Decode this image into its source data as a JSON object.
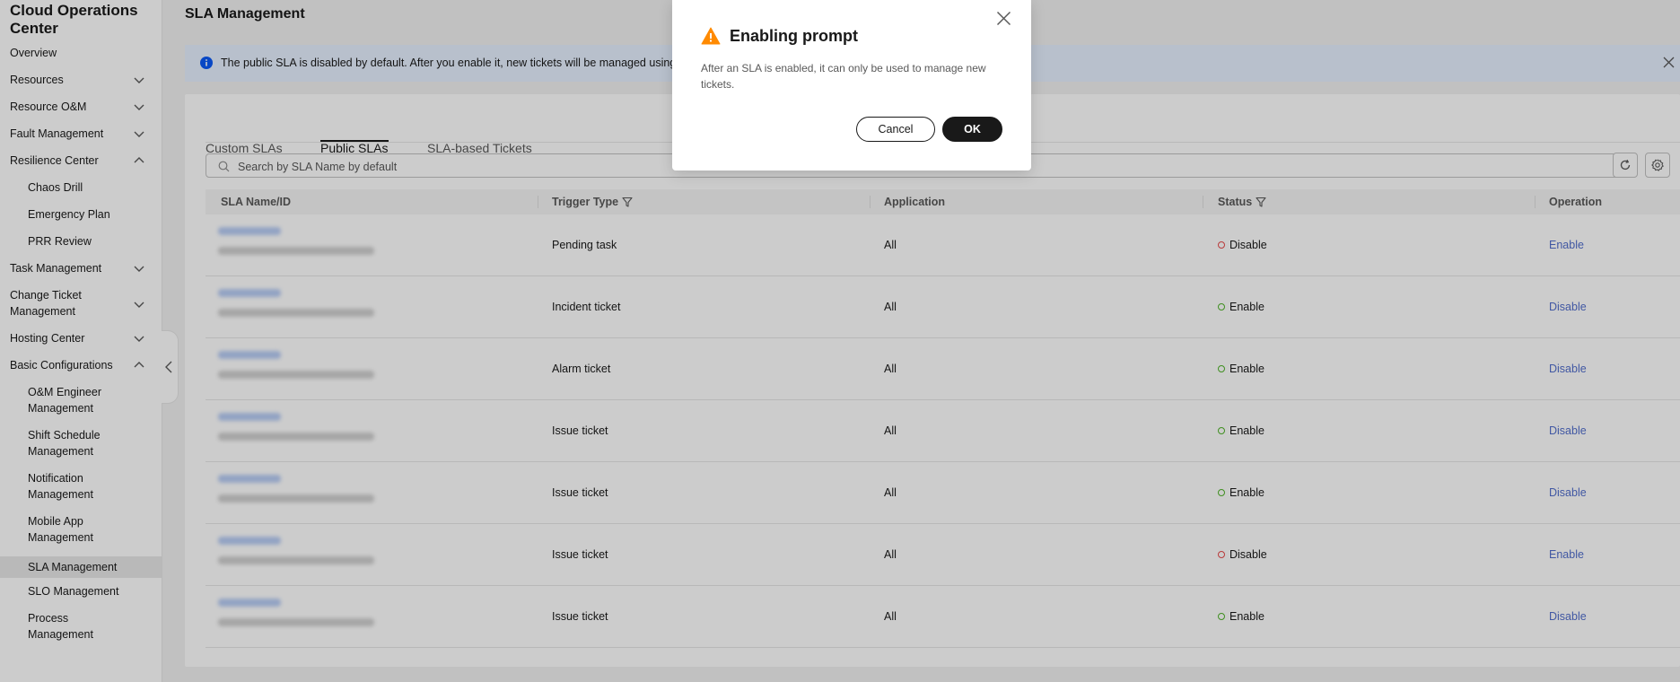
{
  "sidebar": {
    "brand": "Cloud Operations Center",
    "items": [
      {
        "label": "Overview"
      },
      {
        "label": "Resources"
      },
      {
        "label": "Resource O&M"
      },
      {
        "label": "Fault Management"
      },
      {
        "label": "Resilience Center"
      },
      {
        "label": "Chaos Drill"
      },
      {
        "label": "Emergency Plan"
      },
      {
        "label": "PRR Review"
      },
      {
        "label": "Task Management"
      },
      {
        "label": "Change Ticket Management"
      },
      {
        "label": "Hosting Center"
      },
      {
        "label": "Basic Configurations"
      },
      {
        "label": "O&M Engineer Management"
      },
      {
        "label": "Shift Schedule Management"
      },
      {
        "label": "Notification Management"
      },
      {
        "label": "Mobile App Management"
      },
      {
        "label": "SLA Management"
      },
      {
        "label": "SLO Management"
      },
      {
        "label": "Process Management"
      }
    ]
  },
  "page": {
    "title": "SLA Management",
    "banner": "The public SLA is disabled by default. After you enable it, new tickets will be managed using thi"
  },
  "tabs": [
    {
      "label": "Custom SLAs"
    },
    {
      "label": "Public SLAs"
    },
    {
      "label": "SLA-based Tickets"
    }
  ],
  "search": {
    "placeholder": "Search by SLA Name by default"
  },
  "table": {
    "headers": {
      "name": "SLA Name/ID",
      "trigger": "Trigger Type",
      "application": "Application",
      "status": "Status",
      "operation": "Operation"
    },
    "rows": [
      {
        "trigger": "Pending task",
        "application": "All",
        "status": "Disable",
        "operation": "Enable"
      },
      {
        "trigger": "Incident ticket",
        "application": "All",
        "status": "Enable",
        "operation": "Disable"
      },
      {
        "trigger": "Alarm ticket",
        "application": "All",
        "status": "Enable",
        "operation": "Disable"
      },
      {
        "trigger": "Issue ticket",
        "application": "All",
        "status": "Enable",
        "operation": "Disable"
      },
      {
        "trigger": "Issue ticket",
        "application": "All",
        "status": "Enable",
        "operation": "Disable"
      },
      {
        "trigger": "Issue ticket",
        "application": "All",
        "status": "Disable",
        "operation": "Enable"
      },
      {
        "trigger": "Issue ticket",
        "application": "All",
        "status": "Enable",
        "operation": "Disable"
      }
    ]
  },
  "modal": {
    "title": "Enabling prompt",
    "message": "After an SLA is enabled, it can only be used to manage new tickets.",
    "cancel": "Cancel",
    "ok": "OK"
  },
  "colors": {
    "accent": "#526ecc",
    "status_enabled": "#4fb329",
    "status_disabled": "#e84a4a",
    "warning": "#ff8a00",
    "info": "#0a59f7"
  }
}
